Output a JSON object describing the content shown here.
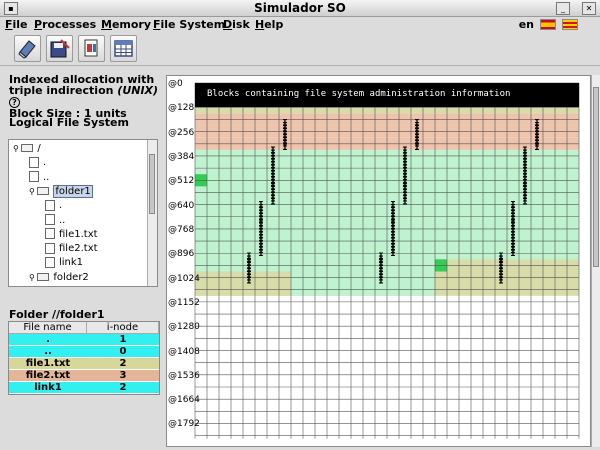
{
  "window": {
    "title": "Simulador SO"
  },
  "menu": [
    {
      "label": "File",
      "key": "F"
    },
    {
      "label": "Processes",
      "key": "P"
    },
    {
      "label": "Memory",
      "key": "M"
    },
    {
      "label": "File System",
      "key": "F"
    },
    {
      "label": "Disk",
      "key": "D"
    },
    {
      "label": "Help",
      "key": "H"
    }
  ],
  "language": {
    "code": "en"
  },
  "toolbar": [
    {
      "name": "tool-1"
    },
    {
      "name": "tool-2"
    },
    {
      "name": "tool-3"
    },
    {
      "name": "tool-4"
    }
  ],
  "info": {
    "line1": "Indexed allocation with",
    "line2_prefix": "triple indirection ",
    "line2_italic": "(UNIX)",
    "help_glyph": "?",
    "line3": "Block Size : 1 units"
  },
  "logical_fs": {
    "title": "Logical File System"
  },
  "tree": [
    {
      "label": "/",
      "type": "folder",
      "level": 0
    },
    {
      "label": ".",
      "type": "file",
      "level": 1
    },
    {
      "label": "..",
      "type": "file",
      "level": 1
    },
    {
      "label": "folder1",
      "type": "folder",
      "level": 1,
      "selected": true
    },
    {
      "label": ".",
      "type": "file",
      "level": 2
    },
    {
      "label": "..",
      "type": "file",
      "level": 2
    },
    {
      "label": "file1.txt",
      "type": "file",
      "level": 2
    },
    {
      "label": "file2.txt",
      "type": "file",
      "level": 2
    },
    {
      "label": "link1",
      "type": "file",
      "level": 2
    },
    {
      "label": "folder2",
      "type": "folder",
      "level": 1
    }
  ],
  "folder_table": {
    "title": "Folder //folder1",
    "headers": [
      "File name",
      "i-node"
    ],
    "rows": [
      {
        "name": ".",
        "inode": "1",
        "color": "#33f0f0"
      },
      {
        "name": "..",
        "inode": "0",
        "color": "#33f0f0"
      },
      {
        "name": "file1.txt",
        "inode": "2",
        "color": "#d8d79a"
      },
      {
        "name": "file2.txt",
        "inode": "3",
        "color": "#e5b59a"
      },
      {
        "name": "link1",
        "inode": "2",
        "color": "#33f0f0"
      }
    ]
  },
  "disk": {
    "banner": "Blocks containing file system administration information",
    "row_labels": [
      "0",
      "128",
      "256",
      "384",
      "512",
      "640",
      "768",
      "896",
      "1024",
      "1152",
      "1280",
      "1408",
      "1536",
      "1664",
      "1792"
    ],
    "marker_glyph": "I",
    "colors": {
      "admin": "#000000",
      "green": "#bff2cf",
      "olive": "#d7dca9",
      "salmon": "#eec4ad",
      "bright_green": "#33cc55",
      "free": "#ffffff",
      "gridline": "#555555"
    }
  }
}
